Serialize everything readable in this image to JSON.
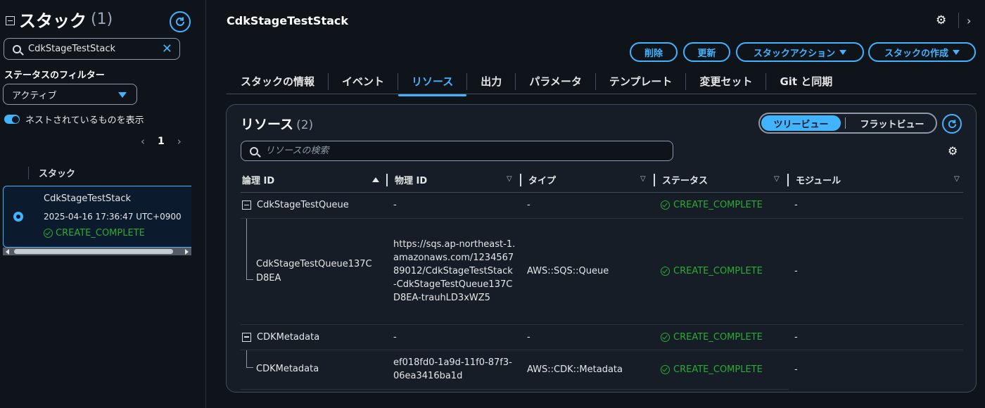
{
  "sidebar": {
    "title": "スタック",
    "count": "(1)",
    "search_value": "CdkStageTestStack",
    "filter_label": "ステータスのフィルター",
    "filter_value": "アクティブ",
    "toggle_label": "ネストされているものを表示",
    "page_current": "1",
    "column_header": "スタック",
    "stack": {
      "name": "CdkStageTestStack",
      "date": "2025-04-16 17:36:47 UTC+0900",
      "status": "CREATE_COMPLETE"
    }
  },
  "header": {
    "title": "CdkStageTestStack"
  },
  "actions": {
    "delete": "削除",
    "update": "更新",
    "stack_actions": "スタックアクション",
    "create_stack": "スタックの作成"
  },
  "tabs": [
    {
      "label": "スタックの情報"
    },
    {
      "label": "イベント"
    },
    {
      "label": "リソース"
    },
    {
      "label": "出力"
    },
    {
      "label": "パラメータ"
    },
    {
      "label": "テンプレート"
    },
    {
      "label": "変更セット"
    },
    {
      "label": "Git と同期"
    }
  ],
  "resources": {
    "title": "リソース",
    "count": "(2)",
    "view_tree": "ツリービュー",
    "view_flat": "フラットビュー",
    "search_placeholder": "リソースの検索",
    "columns": [
      "論理 ID",
      "物理 ID",
      "タイプ",
      "ステータス",
      "モジュール"
    ],
    "rows": [
      {
        "logical": "CdkStageTestQueue",
        "physical": "-",
        "type": "-",
        "status": "CREATE_COMPLETE",
        "module": "-"
      },
      {
        "logical": "CdkStageTestQueue137CD8EA",
        "physical": "https://sqs.ap-northeast-1.amazonaws.com/123456789012/CdkStageTestStack-CdkStageTestQueue137CD8EA-trauhLD3xWZ5",
        "type": "AWS::SQS::Queue",
        "status": "CREATE_COMPLETE",
        "module": "-"
      },
      {
        "logical": "CDKMetadata",
        "physical": "-",
        "type": "-",
        "status": "CREATE_COMPLETE",
        "module": "-"
      },
      {
        "logical": "CDKMetadata",
        "physical": "ef018fd0-1a9d-11f0-87f3-06ea3416ba1d",
        "type": "AWS::CDK::Metadata",
        "status": "CREATE_COMPLETE",
        "module": "-"
      }
    ]
  },
  "colors": {
    "accent": "#42b4ff",
    "success": "#29ad32",
    "background": "#0f141a",
    "panel": "#161d26"
  }
}
